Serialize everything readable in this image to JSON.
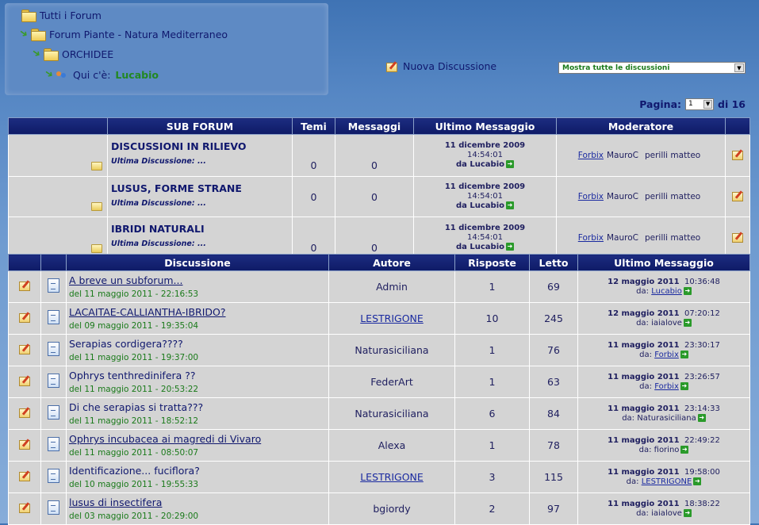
{
  "breadcrumb": {
    "all_forums": "Tutti i Forum",
    "forum": "Forum Piante - Natura Mediterraneo",
    "subforum": "ORCHIDEE",
    "who_label": "Qui c'è:",
    "who_user": "Lucabio"
  },
  "new_discussion": "Nuova Discussione",
  "filter_select": "Mostra tutte le discussioni",
  "pagination": {
    "label": "Pagina:",
    "current": "1",
    "total_label": "di 16"
  },
  "subforum_table": {
    "headers": [
      "SUB FORUM",
      "Temi",
      "Messaggi",
      "Ultimo Messaggio",
      "Moderatore"
    ],
    "rows": [
      {
        "name": "DISCUSSIONI IN RILIEVO",
        "ultima": "Ultima Discussione:  ...",
        "temi": "0",
        "messaggi": "0",
        "date": "11 dicembre 2009",
        "time": "14:54:01",
        "by": "da Lucabio",
        "mods": [
          "Forbix",
          "MauroC",
          "perilli matteo"
        ]
      },
      {
        "name": "LUSUS, FORME STRANE",
        "ultima": "Ultima Discussione:  ...",
        "temi": "0",
        "messaggi": "0",
        "date": "11 dicembre 2009",
        "time": "14:54:01",
        "by": "da Lucabio",
        "mods": [
          "Forbix",
          "MauroC",
          "perilli matteo"
        ]
      },
      {
        "name": "IBRIDI NATURALI",
        "ultima": "Ultima Discussione:  ...",
        "temi": "0",
        "messaggi": "0",
        "date": "11 dicembre 2009",
        "time": "14:54:01",
        "by": "da Lucabio",
        "mods": [
          "Forbix",
          "MauroC",
          "perilli matteo"
        ]
      }
    ]
  },
  "discussion_table": {
    "headers": [
      "Discussione",
      "Autore",
      "Risposte",
      "Letto",
      "Ultimo Messaggio"
    ],
    "rows": [
      {
        "title": "A breve un subforum...",
        "title_link": true,
        "created": "del 11 maggio 2011 - 22:16:53",
        "author": "Admin",
        "author_link": false,
        "replies": "1",
        "reads": "69",
        "last_date": "12 maggio 2011",
        "last_time": "10:36:48",
        "last_by_prefix": "da:",
        "last_by": "Lucabio",
        "last_by_link": true
      },
      {
        "title": "LACAITAE-CALLIANTHA-IBRIDO?",
        "title_link": true,
        "created": "del 09 maggio 2011 - 19:35:04",
        "author": "LESTRIGONE",
        "author_link": true,
        "replies": "10",
        "reads": "245",
        "last_date": "12 maggio 2011",
        "last_time": "07:20:12",
        "last_by_prefix": "da:",
        "last_by": "iaialove",
        "last_by_link": false
      },
      {
        "title": "Serapias cordigera????",
        "title_link": false,
        "created": "del 11 maggio 2011 - 19:37:00",
        "author": "Naturasiciliana",
        "author_link": false,
        "replies": "1",
        "reads": "76",
        "last_date": "11 maggio 2011",
        "last_time": "23:30:17",
        "last_by_prefix": "da:",
        "last_by": "Forbix",
        "last_by_link": true
      },
      {
        "title": "Ophrys tenthredinifera ??",
        "title_link": false,
        "created": "del 11 maggio 2011 - 20:53:22",
        "author": "FederArt",
        "author_link": false,
        "replies": "1",
        "reads": "63",
        "last_date": "11 maggio 2011",
        "last_time": "23:26:57",
        "last_by_prefix": "da:",
        "last_by": "Forbix",
        "last_by_link": true
      },
      {
        "title": "Di che serapias si tratta???",
        "title_link": false,
        "created": "del 11 maggio 2011 - 18:52:12",
        "author": "Naturasiciliana",
        "author_link": false,
        "replies": "6",
        "reads": "84",
        "last_date": "11 maggio 2011",
        "last_time": "23:14:33",
        "last_by_prefix": "da:",
        "last_by": "Naturasiciliana",
        "last_by_link": false
      },
      {
        "title": "Ophrys incubacea ai magredi di Vivaro",
        "title_link": true,
        "created": "del 11 maggio 2011 - 08:50:07",
        "author": "Alexa",
        "author_link": false,
        "replies": "1",
        "reads": "78",
        "last_date": "11 maggio 2011",
        "last_time": "22:49:22",
        "last_by_prefix": "da:",
        "last_by": "fiorino",
        "last_by_link": false
      },
      {
        "title": "Identificazione... fuciflora?",
        "title_link": false,
        "created": "del 10 maggio 2011 - 19:55:33",
        "author": "LESTRIGONE",
        "author_link": true,
        "replies": "3",
        "reads": "115",
        "last_date": "11 maggio 2011",
        "last_time": "19:58:00",
        "last_by_prefix": "da:",
        "last_by": "LESTRIGONE",
        "last_by_link": true
      },
      {
        "title": "lusus di insectifera",
        "title_link": true,
        "created": "del 03 maggio 2011 - 20:29:00",
        "author": "bgiordy",
        "author_link": false,
        "replies": "2",
        "reads": "97",
        "last_date": "11 maggio 2011",
        "last_time": "18:38:22",
        "last_by_prefix": "da:",
        "last_by": "iaialove",
        "last_by_link": false
      }
    ]
  }
}
